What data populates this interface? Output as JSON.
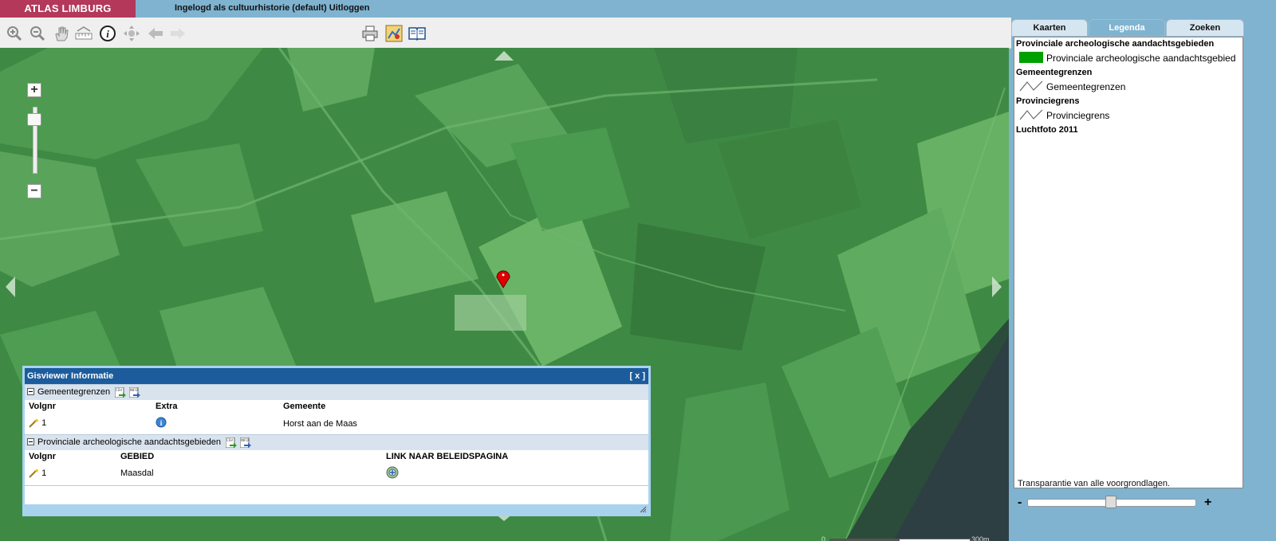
{
  "header": {
    "brand": "ATLAS LIMBURG",
    "login_text": "Ingelogd als cultuurhistorie (default)",
    "logout_label": "Uitloggen"
  },
  "toolbar": {
    "tools": [
      "zoom-in-icon",
      "zoom-out-icon",
      "pan-hand-icon",
      "measure-ruler-icon",
      "info-icon",
      "full-extent-icon",
      "previous-extent-icon",
      "next-extent-icon"
    ],
    "center_tools": [
      "print-icon",
      "map-export-icon",
      "manual-book-icon"
    ]
  },
  "map": {
    "zoom_in": "+",
    "zoom_out": "−",
    "scale": {
      "start": "0",
      "end": "300m"
    }
  },
  "popup": {
    "title": "Gisviewer Informatie",
    "close": "[ x ]",
    "sections": [
      {
        "name": "Gemeentegrenzen",
        "columns": [
          "Volgnr",
          "Extra",
          "Gemeente"
        ],
        "rows": [
          {
            "volgnr": "1",
            "gemeente": "Horst aan de Maas"
          }
        ]
      },
      {
        "name": "Provinciale archeologische aandachtsgebieden",
        "columns": [
          "Volgnr",
          "GEBIED",
          "LINK NAAR BELEIDSPAGINA"
        ],
        "rows": [
          {
            "volgnr": "1",
            "gebied": "Maasdal"
          }
        ]
      }
    ]
  },
  "sidebar": {
    "tabs": [
      {
        "label": "Kaarten",
        "active": false
      },
      {
        "label": "Legenda",
        "active": true
      },
      {
        "label": "Zoeken",
        "active": false
      }
    ],
    "legend": [
      {
        "title": "Provinciale archeologische aandachtsgebieden",
        "item": "Provinciale archeologische aandachtsgebied",
        "swatch": "fill",
        "color": "#00a000"
      },
      {
        "title": "Gemeentegrenzen",
        "item": "Gemeentegrenzen",
        "swatch": "line"
      },
      {
        "title": "Provinciegrens",
        "item": "Provinciegrens",
        "swatch": "line"
      },
      {
        "title": "Luchtfoto 2011"
      }
    ],
    "transparency_label": "Transparantie van alle voorgrondlagen.",
    "transparency_value": 0.5
  },
  "colors": {
    "brand": "#b3385a",
    "header_bg": "#7fb3d0",
    "popup_header": "#1c5c9c",
    "active_tab": "#7fb3d0",
    "marker": "#e00000"
  }
}
